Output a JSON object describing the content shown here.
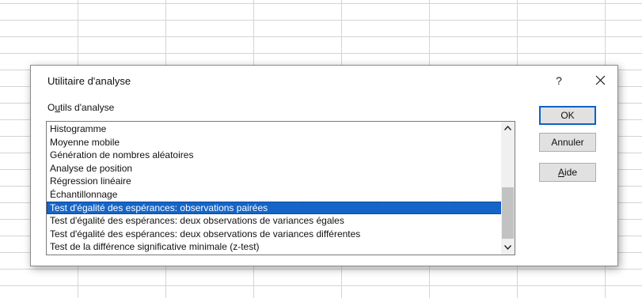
{
  "dialog": {
    "title": "Utilitaire d'analyse",
    "help_label": "?",
    "group_label_accel": "u",
    "group_label_prefix": "O",
    "group_label_rest": "tils d'analyse"
  },
  "tools_list": {
    "items": [
      "Histogramme",
      "Moyenne mobile",
      "Génération de nombres aléatoires",
      "Analyse de position",
      "Régression linéaire",
      "Échantillonnage",
      "Test d'égalité des espérances: observations pairées",
      "Test d'égalité des espérances: deux observations de variances égales",
      "Test d'égalité des espérances: deux observations de variances différentes",
      "Test de la différence significative minimale (z-test)"
    ],
    "selected_index": 6
  },
  "buttons": {
    "ok_label": "OK",
    "cancel_label": "Annuler",
    "help_accel": "A",
    "help_rest": "ide"
  },
  "colors": {
    "selection": "#1565c8",
    "default_button_border": "#0b62c4"
  },
  "icons": {
    "close": "close-icon",
    "scroll_up": "chevron-up-icon",
    "scroll_down": "chevron-down-icon"
  }
}
